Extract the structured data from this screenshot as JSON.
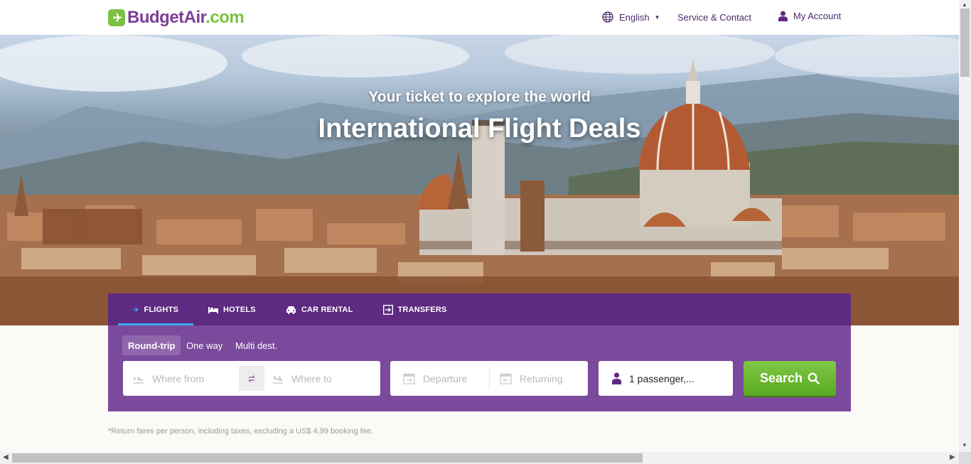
{
  "header": {
    "logo": {
      "brand": "BudgetAir",
      "tld": ".com"
    },
    "language": "English",
    "service": "Service & Contact",
    "account": "My Account"
  },
  "hero": {
    "subtitle": "Your ticket to explore the world",
    "title": "International Flight Deals"
  },
  "search": {
    "tabs": [
      {
        "label": "FLIGHTS",
        "icon": "plane-icon",
        "active": true
      },
      {
        "label": "HOTELS",
        "icon": "bed-icon"
      },
      {
        "label": "CAR RENTAL",
        "icon": "car-icon"
      },
      {
        "label": "TRANSFERS",
        "icon": "transfer-icon"
      }
    ],
    "trip_types": [
      "Round-trip",
      "One way",
      "Multi dest."
    ],
    "selected_trip_type": "Round-trip",
    "from_placeholder": "Where from",
    "to_placeholder": "Where to",
    "departure_placeholder": "Departure",
    "return_placeholder": "Returning",
    "passengers": "1 passenger,...",
    "search_label": "Search"
  },
  "footnote": "*Return fares per person, including taxes, excluding a US$ 4.99 booking fee.",
  "colors": {
    "brand_purple": "#7b3f98",
    "tabs_bg": "#5f2a82",
    "panel_bg": "#7b4a9c",
    "brand_green": "#7bc142",
    "active_tab_indicator": "#3ca9f5"
  }
}
